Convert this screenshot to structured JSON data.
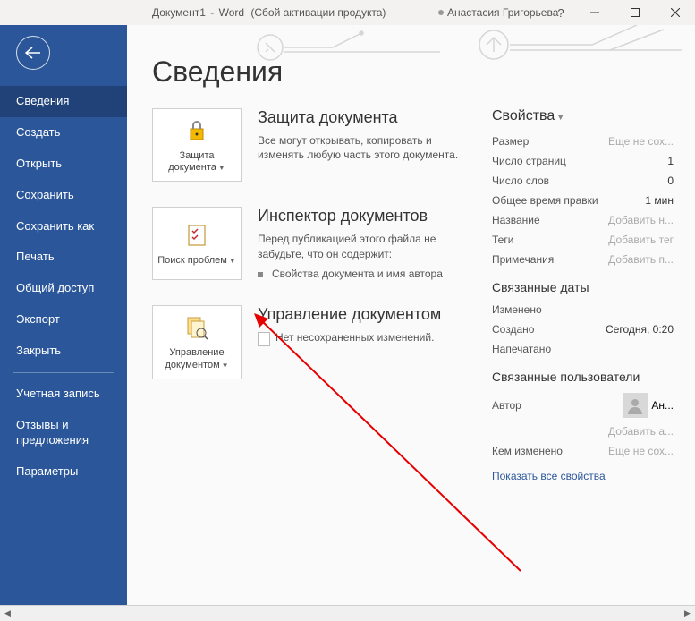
{
  "titlebar": {
    "doc_name": "Документ1",
    "app": "Word",
    "status": "(Сбой активации продукта)",
    "user": "Анастасия Григорьева",
    "help": "?"
  },
  "sidebar": {
    "items": [
      "Сведения",
      "Создать",
      "Открыть",
      "Сохранить",
      "Сохранить как",
      "Печать",
      "Общий доступ",
      "Экспорт",
      "Закрыть"
    ],
    "footer_items": [
      "Учетная запись",
      "Отзывы и предложения",
      "Параметры"
    ]
  },
  "page": {
    "title": "Сведения"
  },
  "protect": {
    "btn_label": "Защита документа",
    "title": "Защита документа",
    "desc": "Все могут открывать, копировать и изменять любую часть этого документа."
  },
  "inspect": {
    "btn_label": "Поиск проблем",
    "title": "Инспектор документов",
    "desc": "Перед публикацией этого файла не забудьте, что он содержит:",
    "bullet": "Свойства документа и имя автора"
  },
  "manage": {
    "btn_label": "Управление документом",
    "title": "Управление документом",
    "desc": "Нет несохраненных изменений."
  },
  "properties": {
    "heading": "Свойства",
    "rows": [
      {
        "label": "Размер",
        "value": "Еще не сох...",
        "placeholder": true
      },
      {
        "label": "Число страниц",
        "value": "1"
      },
      {
        "label": "Число слов",
        "value": "0"
      },
      {
        "label": "Общее время правки",
        "value": "1 мин"
      },
      {
        "label": "Название",
        "value": "Добавить н...",
        "placeholder": true
      },
      {
        "label": "Теги",
        "value": "Добавить тег",
        "placeholder": true
      },
      {
        "label": "Примечания",
        "value": "Добавить п...",
        "placeholder": true
      }
    ],
    "dates_heading": "Связанные даты",
    "dates": [
      {
        "label": "Изменено",
        "value": ""
      },
      {
        "label": "Создано",
        "value": "Сегодня, 0:20"
      },
      {
        "label": "Напечатано",
        "value": ""
      }
    ],
    "users_heading": "Связанные пользователи",
    "author_label": "Автор",
    "author_value": "Ан...",
    "add_author": "Добавить а...",
    "modified_by_label": "Кем изменено",
    "modified_by_value": "Еще не сох...",
    "show_all": "Показать все свойства"
  }
}
